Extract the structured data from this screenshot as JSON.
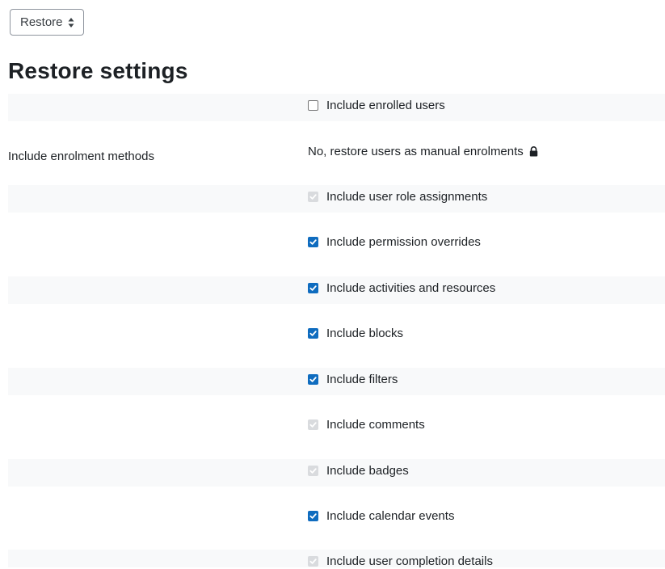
{
  "select": {
    "value": "Restore"
  },
  "page_title": "Restore settings",
  "settings": [
    {
      "left": "",
      "type": "checkbox",
      "state": "unchecked",
      "label": "Include enrolled users"
    },
    {
      "left": "Include enrolment methods",
      "type": "static",
      "label": "No, restore users as manual enrolments",
      "locked": true
    },
    {
      "left": "",
      "type": "checkbox",
      "state": "disabled",
      "label": "Include user role assignments"
    },
    {
      "left": "",
      "type": "checkbox",
      "state": "checked",
      "label": "Include permission overrides"
    },
    {
      "left": "",
      "type": "checkbox",
      "state": "checked",
      "label": "Include activities and resources"
    },
    {
      "left": "",
      "type": "checkbox",
      "state": "checked",
      "label": "Include blocks"
    },
    {
      "left": "",
      "type": "checkbox",
      "state": "checked",
      "label": "Include filters"
    },
    {
      "left": "",
      "type": "checkbox",
      "state": "disabled",
      "label": "Include comments"
    },
    {
      "left": "",
      "type": "checkbox",
      "state": "disabled",
      "label": "Include badges"
    },
    {
      "left": "",
      "type": "checkbox",
      "state": "checked",
      "label": "Include calendar events"
    },
    {
      "left": "",
      "type": "checkbox",
      "state": "disabled",
      "label": "Include user completion details"
    }
  ],
  "colors": {
    "checkbox_checked": "#0f6cbf",
    "checkbox_disabled": "#d9dbde",
    "row_shade": "#f8f9fa"
  },
  "icons": {
    "lock": "lock-icon",
    "select_caret": "sort-caret-icon",
    "check": "check-icon"
  }
}
